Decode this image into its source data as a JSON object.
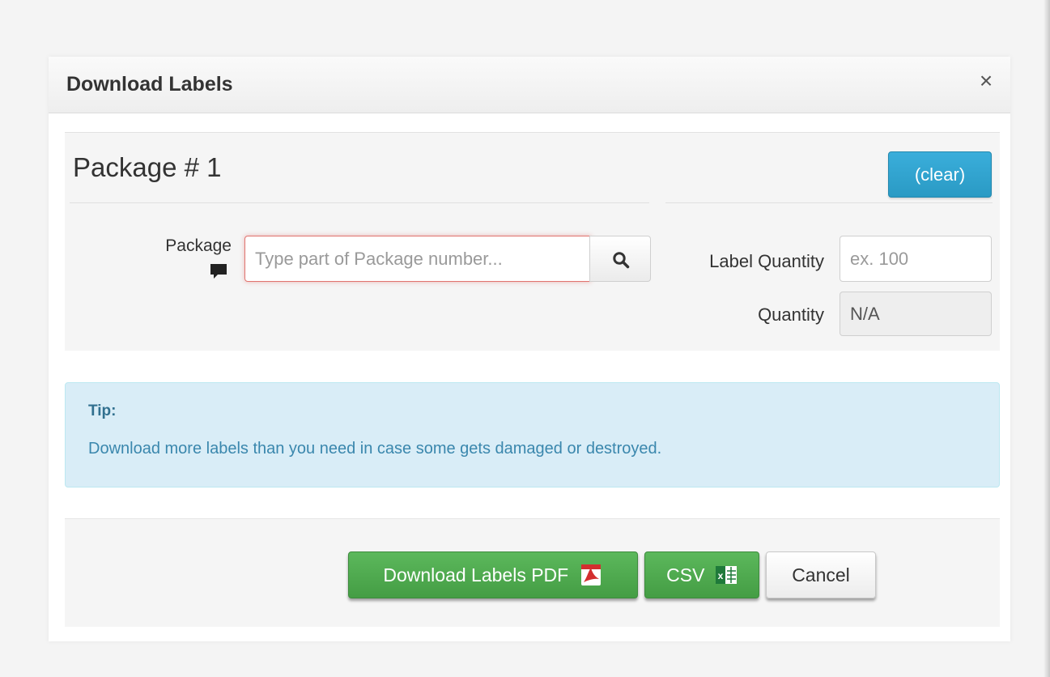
{
  "modal": {
    "title": "Download Labels",
    "close_label": "×"
  },
  "package": {
    "heading": "Package # 1",
    "clear_label": "(clear)",
    "package_label": "Package",
    "package_placeholder": "Type part of Package number...",
    "package_value": "",
    "label_quantity_label": "Label Quantity",
    "label_quantity_placeholder": "ex. 100",
    "quantity_label": "Quantity",
    "quantity_value": "N/A"
  },
  "tip": {
    "title": "Tip:",
    "text": "Download more labels than you need in case some gets damaged or destroyed."
  },
  "footer": {
    "pdf_label": "Download Labels PDF",
    "csv_label": "CSV",
    "cancel_label": "Cancel"
  },
  "icons": {
    "comment": "comment-icon",
    "search": "search-icon",
    "pdf": "pdf-icon",
    "excel": "excel-icon"
  },
  "colors": {
    "primary_blue": "#2a9ac4",
    "success_green": "#5cb85c",
    "tip_background": "#d9edf7",
    "tip_text": "#31708f",
    "input_error_border": "#e0746f"
  }
}
